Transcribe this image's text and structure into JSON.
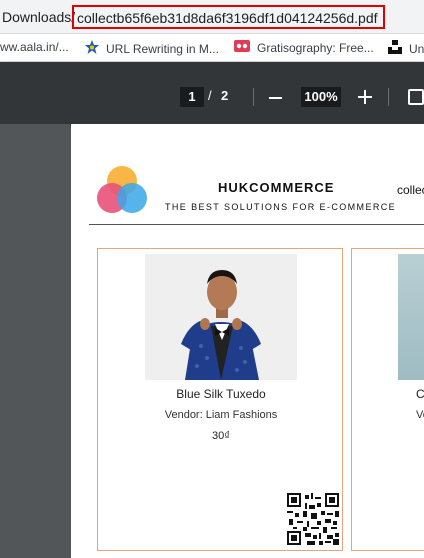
{
  "urlbar": {
    "prefix": "Downloads/",
    "filename": "collectb65f6eb31d8da6f3196df1d04124256d.pdf"
  },
  "bookmarks": [
    {
      "label": "ww.aala.in/..."
    },
    {
      "label": "URL Rewriting in M..."
    },
    {
      "label": "Gratisography: Free..."
    },
    {
      "label": "Un"
    }
  ],
  "toolbar": {
    "current_page": "1",
    "separator": "/",
    "total_pages": "2",
    "zoom": "100%"
  },
  "header": {
    "brand": "HUKCOMMERCE",
    "tagline": "THE BEST SOLUTIONS FOR E-COMMERCE",
    "collection_title": "collec"
  },
  "products": [
    {
      "name": "Blue Silk Tuxedo",
      "vendor": "Vendor: Liam Fashions",
      "price": "30₫"
    },
    {
      "name": "C",
      "vendor": "Ve"
    }
  ],
  "colors": {
    "highlight": "#e00000",
    "card_border": "#e7a57e",
    "toolbar": "#323639"
  }
}
